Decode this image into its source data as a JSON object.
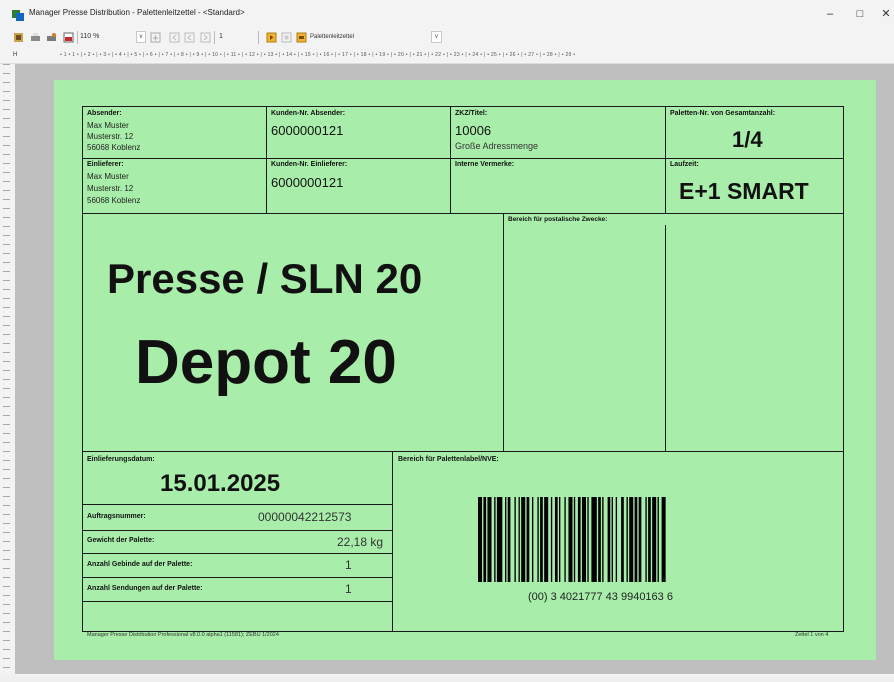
{
  "window": {
    "title": "Manager Presse Distribution - Palettenleitzettel - <Standard>",
    "minimize_icon": "minimize-icon",
    "maximize_icon": "maximize-icon",
    "close_icon": "close-icon"
  },
  "toolbar": {
    "zoom": "110 %",
    "page": "1",
    "report": "Palettenleitzettel"
  },
  "ruler": {
    "corner": "H",
    "ticks": "• 1 • 1 • | • 2 • | • 3 • | • 4 • | • 5 • | • 6 • | • 7 • | • 8 • | • 9 • | • 10 • | • 11 • | • 12 • | • 13 • | • 14 • | • 15 • | • 16 • | • 17 • | • 18 • | • 19 • | • 20 • | • 21 • | • 22 • | • 23 • | • 24 • | • 25 • | • 26 • | • 27 • | • 28 • | • 29 •"
  },
  "label": {
    "absender": {
      "title": "Absender:",
      "name": "Max Muster",
      "street": "Musterstr. 12",
      "city": "56068 Koblenz"
    },
    "kunden_absender": {
      "title": "Kunden-Nr. Absender:",
      "value": "6000000121"
    },
    "zkz": {
      "title": "ZKZ/Titel:",
      "value": "10006",
      "sub": "Große Adressmenge"
    },
    "paletten": {
      "title": "Paletten-Nr. von Gesamtanzahl:",
      "value": "1/4"
    },
    "einlieferer": {
      "title": "Einlieferer:",
      "name": "Max Muster",
      "street": "Musterstr. 12",
      "city": "56068 Koblenz"
    },
    "kunden_einlieferer": {
      "title": "Kunden-Nr. Einlieferer:",
      "value": "6000000121"
    },
    "interne": {
      "title": "Interne Vermerke:"
    },
    "laufzeit": {
      "title": "Laufzeit:",
      "value": "E+1 SMART"
    },
    "destination_line1": "Presse / SLN 20",
    "destination_line2": "Depot 20",
    "postal_area": {
      "title": "Bereich für postalische Zwecke:"
    },
    "einlieferungsdatum": {
      "title": "Einlieferungsdatum:",
      "value": "15.01.2025"
    },
    "auftragsnummer": {
      "title": "Auftragsnummer:",
      "value": "00000042212573"
    },
    "gewicht": {
      "title": "Gewicht der Palette:",
      "value": "22,18 kg"
    },
    "gebinde": {
      "title": "Anzahl Gebinde auf der Palette:",
      "value": "1"
    },
    "sendungen": {
      "title": "Anzahl Sendungen auf der Palette:",
      "value": "1"
    },
    "nve": {
      "title": "Bereich für Palettenlabel/NVE:",
      "barcode_text": "(00) 3 4021777 43 9940163 6"
    },
    "footer_left": "Manager Presse Distribution Professional v8.0.0 alpha1 (11581); ZEBU 1/2024",
    "footer_right": "Zettel 1 von 4"
  }
}
